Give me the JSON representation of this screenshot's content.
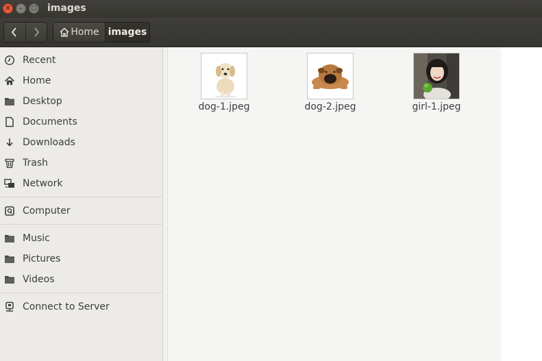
{
  "window": {
    "title": "images"
  },
  "toolbar": {
    "breadcrumbs": [
      {
        "label": "Home"
      },
      {
        "label": "images"
      }
    ]
  },
  "sidebar": {
    "items": [
      {
        "label": "Recent",
        "icon": "clock-icon"
      },
      {
        "label": "Home",
        "icon": "home-icon"
      },
      {
        "label": "Desktop",
        "icon": "folder-icon"
      },
      {
        "label": "Documents",
        "icon": "document-icon"
      },
      {
        "label": "Downloads",
        "icon": "download-icon"
      },
      {
        "label": "Trash",
        "icon": "trash-icon"
      },
      {
        "label": "Network",
        "icon": "network-icon"
      },
      {
        "label": "Computer",
        "icon": "drive-icon"
      },
      {
        "label": "Music",
        "icon": "folder-icon"
      },
      {
        "label": "Pictures",
        "icon": "folder-icon"
      },
      {
        "label": "Videos",
        "icon": "folder-icon"
      },
      {
        "label": "Connect to Server",
        "icon": "server-icon"
      }
    ]
  },
  "files": [
    {
      "name": "dog-1.jpeg",
      "thumbnail": "puppy-thumbnail"
    },
    {
      "name": "dog-2.jpeg",
      "thumbnail": "shar-pei-thumbnail"
    },
    {
      "name": "girl-1.jpeg",
      "thumbnail": "portrait-thumbnail"
    }
  ],
  "colors": {
    "titlebar": "#3c3b37",
    "close_button": "#e8593a",
    "sidebar_bg": "#ecebe8",
    "content_bg": "#f5f5f4"
  }
}
